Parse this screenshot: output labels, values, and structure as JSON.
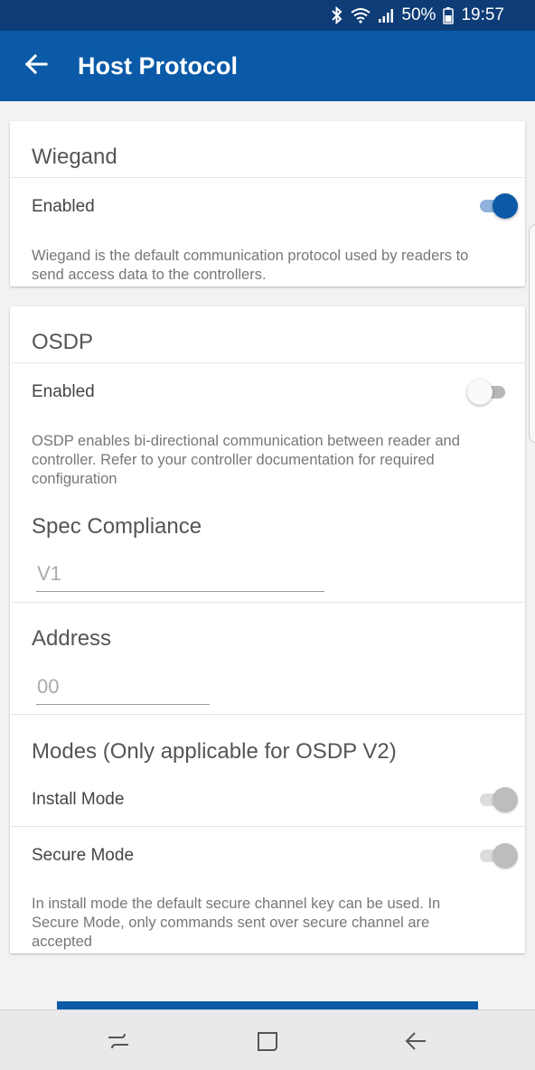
{
  "status_bar": {
    "battery": "50%",
    "time": "19:57",
    "icons": [
      "bluetooth-icon",
      "wifi-icon",
      "signal-icon",
      "battery-icon"
    ]
  },
  "app_bar": {
    "title": "Host Protocol",
    "back_icon": "arrow-left-icon",
    "color": "#0a5aa8"
  },
  "wiegand": {
    "title": "Wiegand",
    "enabled_label": "Enabled",
    "enabled": true,
    "description": "Wiegand is the default communication protocol used by readers to send access data to the controllers."
  },
  "osdp": {
    "title": "OSDP",
    "enabled_label": "Enabled",
    "enabled": false,
    "description": "OSDP enables bi-directional communication between reader and controller. Refer to your controller documentation for required configuration",
    "spec_compliance": {
      "label": "Spec Compliance",
      "value": "V1"
    },
    "address": {
      "label": "Address",
      "value": "00"
    },
    "modes": {
      "title": "Modes (Only applicable for OSDP V2)",
      "install_label": "Install Mode",
      "secure_label": "Secure Mode",
      "description": "In install mode the default secure channel key can be used. In Secure Mode, only commands sent over secure channel are accepted"
    }
  },
  "nav_bar": {
    "icons": [
      "recent-apps-icon",
      "home-icon",
      "back-icon"
    ]
  }
}
